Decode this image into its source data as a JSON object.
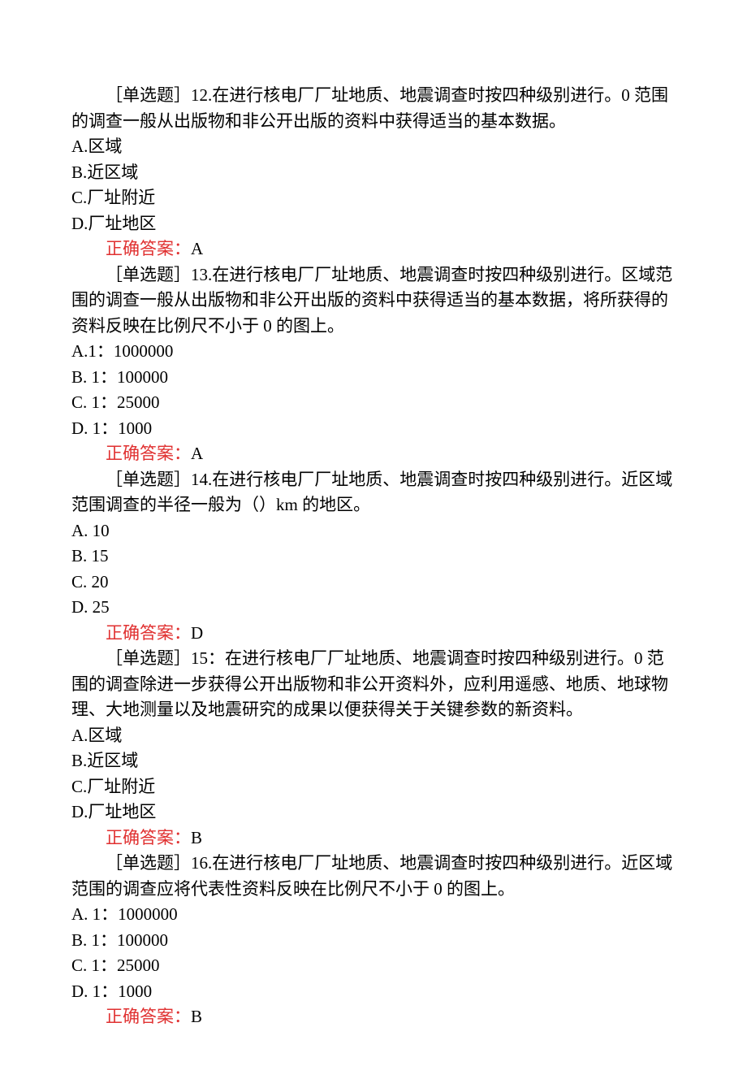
{
  "questions": [
    {
      "tag": "［单选题］12.",
      "stem": "在进行核电厂厂址地质、地震调查时按四种级别进行。0 范围的调查一般从出版物和非公开出版的资料中获得适当的基本数据。",
      "options": [
        "A.区域",
        "B.近区域",
        "C.厂址附近",
        "D.厂址地区"
      ],
      "answer_label": "正确答案：",
      "answer_value": "A"
    },
    {
      "tag": "［单选题］13.",
      "stem": "在进行核电厂厂址地质、地震调查时按四种级别进行。区域范围的调查一般从出版物和非公开出版的资料中获得适当的基本数据，将所获得的资料反映在比例尺不小于 0 的图上。",
      "options": [
        "A.1：1000000",
        "B. 1：100000",
        "C. 1：25000",
        "D. 1：1000"
      ],
      "answer_label": "正确答案：",
      "answer_value": "A"
    },
    {
      "tag": "［单选题］14.",
      "stem": "在进行核电厂厂址地质、地震调查时按四种级别进行。近区域范围调查的半径一般为（）km 的地区。",
      "options": [
        "A. 10",
        "B. 15",
        "C. 20",
        "D. 25"
      ],
      "answer_label": "正确答案：",
      "answer_value": "D"
    },
    {
      "tag": "［单选题］15：",
      "stem": "在进行核电厂厂址地质、地震调查时按四种级别进行。0 范围的调查除进一步获得公开出版物和非公开资料外，应利用遥感、地质、地球物理、大地测量以及地震研究的成果以便获得关于关键参数的新资料。",
      "options": [
        "A.区域",
        "B.近区域",
        "C.厂址附近",
        "D.厂址地区"
      ],
      "answer_label": "正确答案：",
      "answer_value": "B"
    },
    {
      "tag": "［单选题］16.",
      "stem": "在进行核电厂厂址地质、地震调查时按四种级别进行。近区域范围的调查应将代表性资料反映在比例尺不小于 0 的图上。",
      "options": [
        "A. 1：1000000",
        "B. 1：100000",
        "C. 1：25000",
        "D. 1：1000"
      ],
      "answer_label": "正确答案：",
      "answer_value": "B"
    }
  ]
}
